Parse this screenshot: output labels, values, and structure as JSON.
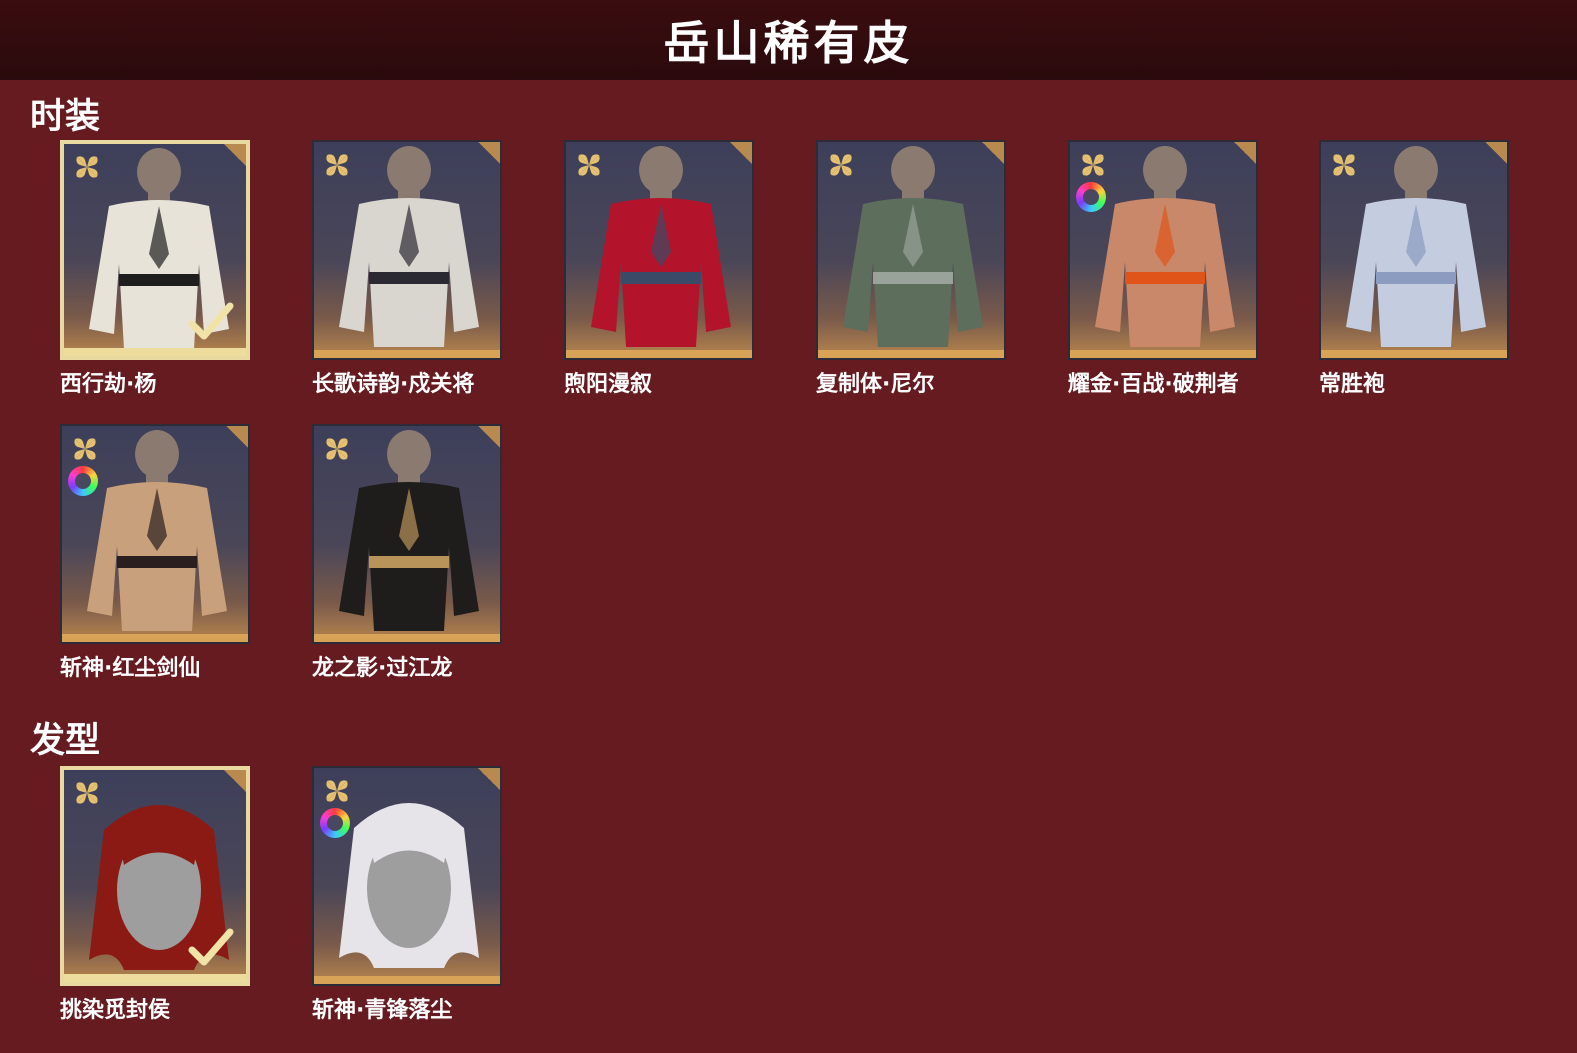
{
  "title": "岳山稀有皮",
  "sections": [
    {
      "title": "时装",
      "items": [
        {
          "name": "西行劫·杨",
          "selected": true,
          "dye": false,
          "color": "#e8e3d8",
          "accent": "#1e1e1e"
        },
        {
          "name": "长歌诗韵·戍关将",
          "selected": false,
          "dye": false,
          "color": "#d9d6cf",
          "accent": "#2b2a33"
        },
        {
          "name": "煦阳漫叙",
          "selected": false,
          "dye": false,
          "color": "#b3142c",
          "accent": "#3b4a66"
        },
        {
          "name": "复制体·尼尔",
          "selected": false,
          "dye": false,
          "color": "#5d6e5c",
          "accent": "#9aa39a"
        },
        {
          "name": "耀金·百战·破荆者",
          "selected": false,
          "dye": true,
          "color": "#c9886a",
          "accent": "#e0541a"
        },
        {
          "name": "常胜袍",
          "selected": false,
          "dye": false,
          "color": "#c4cde0",
          "accent": "#8c9bc0"
        },
        {
          "name": "斩神·红尘剑仙",
          "selected": false,
          "dye": true,
          "color": "#c9a07c",
          "accent": "#2a1e1e"
        },
        {
          "name": "龙之影·过江龙",
          "selected": false,
          "dye": false,
          "color": "#1f1c1c",
          "accent": "#b8935a"
        }
      ]
    },
    {
      "title": "发型",
      "items": [
        {
          "name": "挑染觅封侯",
          "selected": true,
          "dye": false,
          "color": "#8c1a14",
          "accent": "#d8d8d8"
        },
        {
          "name": "斩神·青锋落尘",
          "selected": false,
          "dye": true,
          "color": "#e6e4e8",
          "accent": "#d8d8d8"
        }
      ]
    }
  ],
  "icons": {
    "rarity": "flower-icon",
    "dye": "dye-color-wheel-icon",
    "owned": "checkmark-icon"
  }
}
